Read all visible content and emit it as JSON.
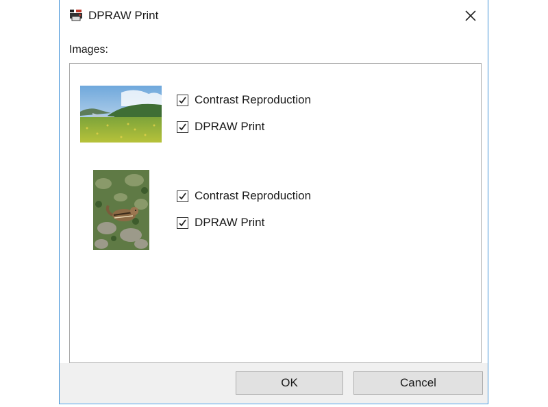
{
  "window": {
    "title": "DPRAW Print",
    "close_icon": "close-icon",
    "app_icon": "printer-icon"
  },
  "images_label": "Images:",
  "images": [
    {
      "thumbnail": "landscape-meadow-lake",
      "options": [
        {
          "label": "Contrast Reproduction",
          "checked": true
        },
        {
          "label": "DPRAW Print",
          "checked": true
        }
      ]
    },
    {
      "thumbnail": "chipmunk-on-rocks",
      "options": [
        {
          "label": "Contrast Reproduction",
          "checked": true
        },
        {
          "label": "DPRAW Print",
          "checked": true
        }
      ]
    }
  ],
  "buttons": {
    "ok": "OK",
    "cancel": "Cancel"
  },
  "colors": {
    "window_border": "#3c8fd6",
    "button_bar": "#f0f0f0",
    "button_face": "#e1e1e1"
  }
}
